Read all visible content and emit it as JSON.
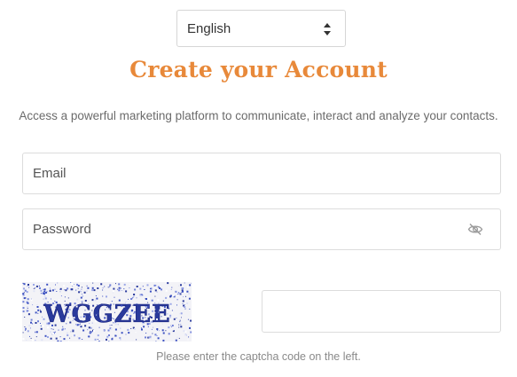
{
  "language_select": {
    "selected": "English"
  },
  "heading": {
    "title": "Create your Account",
    "subtitle": "Access a powerful marketing platform to communicate, interact and analyze your contacts."
  },
  "form": {
    "email_placeholder": "Email",
    "email_value": "",
    "password_placeholder": "Password",
    "password_value": "",
    "captcha_value": "",
    "captcha_hint": "Please enter the captcha code on the left."
  },
  "captcha": {
    "code": "WGGZEE"
  },
  "colors": {
    "title": "#e8893a",
    "captcha_text": "#2a3a9c",
    "border": "#dcdcdc",
    "muted_text": "#8a8a8a"
  },
  "icons": {
    "password_toggle": "eye-slash-icon",
    "select_arrows": "sort-arrows-icon"
  }
}
